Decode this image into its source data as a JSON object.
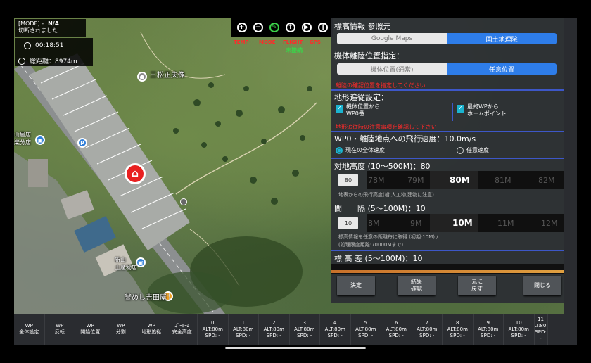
{
  "status": {
    "mode_tag": "[MODE] -",
    "mode_value": "N/A",
    "connection": "切断されました",
    "flight_time": "00:18:51",
    "total_distance": "総距離：8974m"
  },
  "toolbar": {
    "icons": [
      "plus-icon",
      "minus-icon",
      "pencil-icon",
      "upload-icon",
      "play-icon",
      "pause-icon"
    ],
    "labels": {
      "temp": "TEMP",
      "mode": "MODE",
      "flight": "FLIGHT",
      "gps": "GPS",
      "unconnected": "未接続"
    }
  },
  "map_labels": {
    "statue": "三松正夫像",
    "parking_left": "山屋店\n楽分店",
    "shinzan": "新山\n土産物店",
    "yoshidaya": "釜めし吉田屋"
  },
  "panel": {
    "elevation_source_label": "標高情報 参照元",
    "source_options": [
      "Google Maps",
      "国土地理院"
    ],
    "takeoff_label": "機体離陸位置指定：",
    "takeoff_options": [
      "機体位置(通常)",
      "任意位置"
    ],
    "takeoff_warning": "離陸の確認位置を指定してください",
    "terrain_label": "地形追従設定：",
    "terrain_opt1": [
      "機体位置から",
      "WP0番"
    ],
    "terrain_opt2": [
      "最終WPから",
      "ホームポイント"
    ],
    "terrain_warning": "地形追従時の注意事項を確認して下さい",
    "speed_label": "WP0・離陸地点への飛行速度：10.0m/s",
    "speed_radio": [
      "現在の全体速度",
      "任意速度"
    ],
    "altitude_label": "対地高度 (10～500M)：80",
    "altitude_box": "80",
    "altitude_picker": [
      "78M",
      "79M",
      "80M",
      "81M",
      "82M"
    ],
    "altitude_hint": "地表からの飛行高度(樹,人工物,建物に注意)",
    "interval_label": "間　　隔 (5～100M)：10",
    "interval_box": "10",
    "interval_picker": [
      "8M",
      "9M",
      "10M",
      "11M",
      "12M"
    ],
    "interval_hint1": "標高情報を任意の距離毎に取得 (初期:10M) /",
    "interval_hint2": "(処理限度距離:70000Mまで)",
    "diff_label": "標 高 差 (5～100M)：10",
    "buttons": {
      "ok": "決定",
      "result": [
        "結果",
        "確認"
      ],
      "revert": [
        "元に",
        "戻す"
      ],
      "close": "閉じる"
    }
  },
  "waypoint_bar": {
    "functions": [
      [
        "WP",
        "全体設定"
      ],
      [
        "WP",
        "反転"
      ],
      [
        "WP",
        "開始位置"
      ],
      [
        "WP",
        "分割"
      ],
      [
        "WP",
        "地形追従"
      ],
      [
        "ｺﾞｰﾙｰﾑ",
        "安全高度"
      ]
    ],
    "points": [
      {
        "id": "0",
        "alt": "ALT:80m",
        "spd": "SPD: -"
      },
      {
        "id": "1",
        "alt": "ALT:80m",
        "spd": "SPD: -"
      },
      {
        "id": "2",
        "alt": "ALT:80m",
        "spd": "SPD: -"
      },
      {
        "id": "3",
        "alt": "ALT:80m",
        "spd": "SPD: -"
      },
      {
        "id": "4",
        "alt": "ALT:80m",
        "spd": "SPD: -"
      },
      {
        "id": "5",
        "alt": "ALT:80m",
        "spd": "SPD: -"
      },
      {
        "id": "6",
        "alt": "ALT:80m",
        "spd": "SPD: -"
      },
      {
        "id": "7",
        "alt": "ALT:80m",
        "spd": "SPD: -"
      },
      {
        "id": "8",
        "alt": "ALT:80m",
        "spd": "SPD: -"
      },
      {
        "id": "9",
        "alt": "ALT:80m",
        "spd": "SPD: -"
      },
      {
        "id": "10",
        "alt": "ALT:80m",
        "spd": "SPD: -"
      },
      {
        "id": "11",
        "alt": "ALT:80m",
        "spd": "SPD: -"
      }
    ]
  },
  "colors": {
    "accent": "#2e7de9",
    "warning": "#ff2a2a",
    "ok": "#3cd24a",
    "check": "#1bb4d0"
  }
}
